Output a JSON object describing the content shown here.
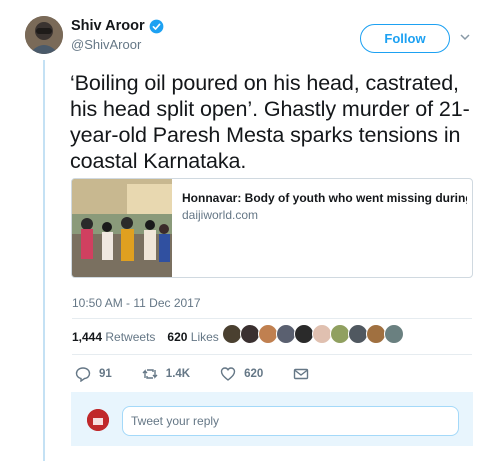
{
  "author": {
    "display_name": "Shiv Aroor",
    "handle": "@ShivAroor",
    "verified": true,
    "avatar_icon": "profile-photo"
  },
  "follow_label": "Follow",
  "tweet": {
    "text": "‘Boiling oil poured on his head, castrated, his head split open’. Ghastly murder of 21-year-old Paresh Mesta sparks tensions in coastal Karnataka."
  },
  "card": {
    "title": "Honnavar: Body of youth who went missing during ...",
    "domain": "daijiworld.com"
  },
  "timestamp": "10:50 AM - 11 Dec 2017",
  "stats": {
    "retweets_count": "1,444",
    "retweets_label": "Retweets",
    "likes_count": "620",
    "likes_label": "Likes"
  },
  "actions": {
    "replies": "91",
    "retweets": "1.4K",
    "likes": "620"
  },
  "reply": {
    "placeholder": "Tweet your reply"
  },
  "colors": {
    "accent": "#1da1f2",
    "secondary_text": "#657786",
    "reply_bg": "#e8f5fd"
  }
}
